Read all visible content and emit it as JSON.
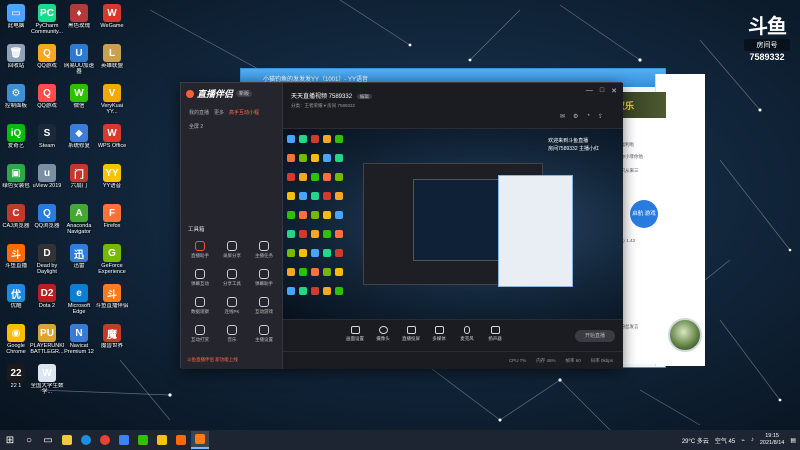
{
  "watermark": {
    "logo": "斗鱼",
    "room_label": "房间号",
    "room_number": "7589332"
  },
  "desktop_icons": [
    {
      "label": "此电脑",
      "color": "#4aa3ff",
      "glyph": "▭"
    },
    {
      "label": "PyCharm Community...",
      "color": "#21d789",
      "glyph": "PC"
    },
    {
      "label": "黑色玫瑰",
      "color": "#b23a3a",
      "glyph": "♦"
    },
    {
      "label": "WeGame",
      "color": "#d33a2c",
      "glyph": "W"
    },
    {
      "label": "回收站",
      "color": "#8fa3b8",
      "glyph": "🗑"
    },
    {
      "label": "QQ游戏",
      "color": "#f5a623",
      "glyph": "Q"
    },
    {
      "label": "网易UU加速器",
      "color": "#2e7ad1",
      "glyph": "U"
    },
    {
      "label": "英雄联盟",
      "color": "#c8a050",
      "glyph": "L"
    },
    {
      "label": "控制面板",
      "color": "#3d8fd1",
      "glyph": "⚙"
    },
    {
      "label": "QQ游戏",
      "color": "#ff4d4d",
      "glyph": "Q"
    },
    {
      "label": "微信",
      "color": "#2dc100",
      "glyph": "W"
    },
    {
      "label": "VeryKuai YY...",
      "color": "#f2a900",
      "glyph": "V"
    },
    {
      "label": "爱奇艺",
      "color": "#00be06",
      "glyph": "iQ"
    },
    {
      "label": "Steam",
      "color": "#1b2838",
      "glyph": "S"
    },
    {
      "label": "系统修复",
      "color": "#3b7dd8",
      "glyph": "◆"
    },
    {
      "label": "WPS Office",
      "color": "#d63a2f",
      "glyph": "W"
    },
    {
      "label": "绿色安装包",
      "color": "#2aa84a",
      "glyph": "▣"
    },
    {
      "label": "uView 2019",
      "color": "#7a8fa3",
      "glyph": "u"
    },
    {
      "label": "六扇门",
      "color": "#c0392b",
      "glyph": "门"
    },
    {
      "label": "YY语音",
      "color": "#f6c500",
      "glyph": "YY"
    },
    {
      "label": "CAJ浏览器",
      "color": "#c0392b",
      "glyph": "C"
    },
    {
      "label": "QQ浏览器",
      "color": "#2a7be0",
      "glyph": "Q"
    },
    {
      "label": "Anaconda Navigator",
      "color": "#44a833",
      "glyph": "A"
    },
    {
      "label": "Firefox",
      "color": "#ff7139",
      "glyph": "F"
    },
    {
      "label": "斗鱼直播",
      "color": "#ff6a00",
      "glyph": "斗"
    },
    {
      "label": "Dead by Daylight",
      "color": "#333333",
      "glyph": "D"
    },
    {
      "label": "迅雷",
      "color": "#2f7de1",
      "glyph": "迅"
    },
    {
      "label": "GeForce Experience",
      "color": "#76b900",
      "glyph": "G"
    },
    {
      "label": "优酷",
      "color": "#1e88e5",
      "glyph": "优"
    },
    {
      "label": "Dota 2",
      "color": "#b22222",
      "glyph": "D2"
    },
    {
      "label": "Microsoft Edge",
      "color": "#0c7fd1",
      "glyph": "e"
    },
    {
      "label": "斗鱼直播伴侣",
      "color": "#ff7a1a",
      "glyph": "斗"
    },
    {
      "label": "Google Chrome",
      "color": "#fbbc05",
      "glyph": "◉"
    },
    {
      "label": "PLAYERUNKNOWN'S BATTLEGR...",
      "color": "#d9a43a",
      "glyph": "PU"
    },
    {
      "label": "Navicat Premium 12",
      "color": "#3a7bd5",
      "glyph": "N"
    },
    {
      "label": "魔兽世界",
      "color": "#c23b22",
      "glyph": "魔"
    },
    {
      "label": "22 1",
      "color": "#1a1a1a",
      "glyph": "22"
    },
    {
      "label": "全国大学生数学...",
      "color": "#dde6f0",
      "glyph": "W"
    }
  ],
  "yy_window": {
    "title": "小猫钓鱼的发发发YY（1001）- YY语音"
  },
  "chat_panel": {
    "banner": "双乐",
    "avatar_label": "启航 游戏",
    "lines": [
      "发福利啦",
      "给你小菲你他",
      "结识从来三",
      "中心 1.43",
      "对粉丝发言"
    ]
  },
  "broadcaster": {
    "brand": "直播伴侣",
    "version_badge": "新版",
    "tabs": [
      "我的直播",
      "更多",
      "高手互动小程"
    ],
    "scene": "全屏 2",
    "tools_title": "工具箱",
    "tools": [
      "直播助手",
      "录屏分享",
      "主播任务",
      "弹幕互动",
      "分享工具",
      "弹幕助手",
      "数据观察",
      "连线PK",
      "互动游戏",
      "互动打赏",
      "音乐",
      "主播设置"
    ],
    "bottom_note": "斗鱼直播伴侣 新功能上线",
    "room_title": "天天直播视频 7589332",
    "room_tag": "编辑",
    "room_sub": "分类：王者荣耀 ▾  房间 7589332",
    "window_controls": [
      "—",
      "□",
      "✕"
    ],
    "preview_text": [
      "欢迎来到斗鱼直播",
      "房间7589332 主播小红"
    ],
    "controls": [
      "画面设置",
      "摄像头",
      "直播投屏",
      "多媒体",
      "麦克风",
      "扬声器"
    ],
    "start_button": "开始直播",
    "status": [
      "CPU 7%",
      "内存 45%",
      "帧率 60",
      "码率 0kbps"
    ]
  },
  "taskbar": {
    "weather": "29°C 多云",
    "tray_text": "空气 45",
    "time": "19:15",
    "date": "2021/8/14"
  }
}
